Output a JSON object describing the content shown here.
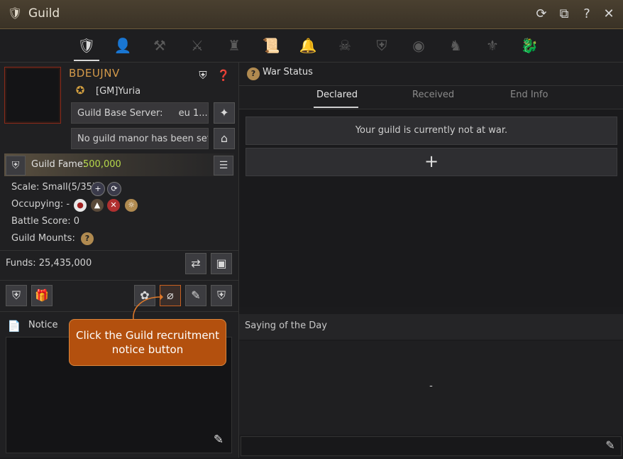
{
  "window": {
    "title": "Guild"
  },
  "guild": {
    "name": "BDEUJNV",
    "master": "[GM]Yuria",
    "base_server_label": "Guild Base Server:",
    "base_server_value": "eu    1...",
    "manor_text": "No guild manor has been set.",
    "fame_label": "Guild Fame:",
    "fame_value": "500,000",
    "scale": "Scale: Small(5/35)",
    "occupying": "Occupying: -",
    "battle_score": "Battle Score: 0",
    "mounts": "Guild Mounts:",
    "funds": "Funds: 25,435,000"
  },
  "notice": {
    "label": "Notice"
  },
  "war": {
    "title": "War Status",
    "tabs": [
      "Declared",
      "Received",
      "End Info"
    ],
    "message": "Your guild is currently not at war.",
    "add_symbol": "+"
  },
  "saying": {
    "title": "Saying of the Day",
    "text": "-"
  },
  "tooltip": {
    "text": "Click the Guild recruitment notice button"
  }
}
